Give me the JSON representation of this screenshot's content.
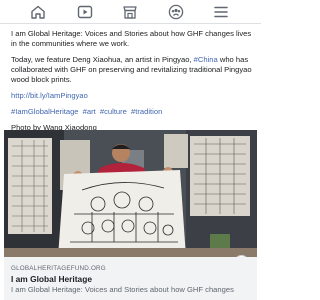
{
  "nav": {
    "icons": [
      "home-icon",
      "video-icon",
      "marketplace-icon",
      "groups-icon",
      "menu-icon"
    ]
  },
  "post": {
    "intro": "I am Global Heritage: Voices and Stories about how GHF changes lives in the communities where we work.",
    "body_prefix": "Today, we feature Deng Xiaohua, an artist in Pingyao, ",
    "body_hashtag": "#China",
    "body_suffix": " who has collaborated with GHF on preserving and revitalizing traditional Pingyao wood block prints.",
    "link": "http://bit.ly/IamPingyao",
    "hashtags": [
      "#IamGlobalHeritage",
      "#art",
      "#culture",
      "#tradition"
    ],
    "credit": "Photo by Wang Xiaodong"
  },
  "preview": {
    "domain": "GLOBALHERITAGEFUND.ORG",
    "title": "I am Global Heritage",
    "description": "I am Global Heritage: Voices and Stories about how GHF changes",
    "info_label": "i"
  }
}
